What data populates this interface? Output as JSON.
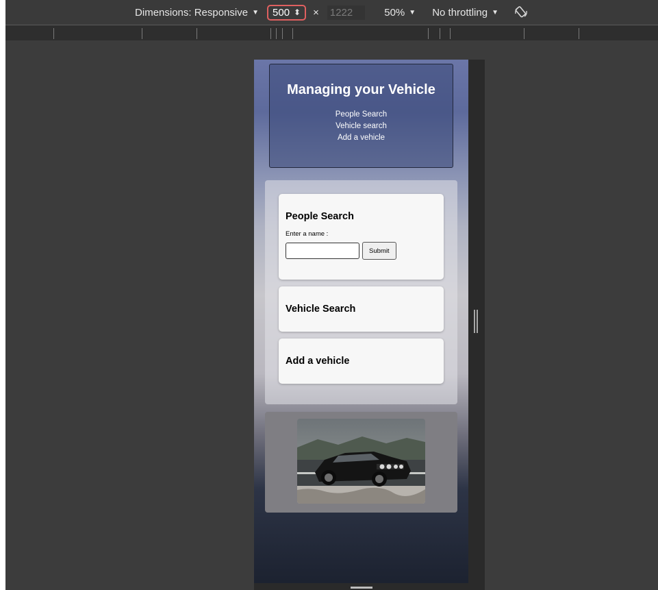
{
  "devtools": {
    "dimensions_label": "Dimensions: Responsive",
    "width_value": "500",
    "times_symbol": "×",
    "height_value": "1222",
    "zoom_label": "50%",
    "throttling_label": "No throttling",
    "icons": {
      "dimensions_dropdown": "chevron-down-icon",
      "width_spinner": "spinner-icon",
      "rotate": "rotate-icon"
    }
  },
  "page": {
    "header": {
      "title": "Managing your Vehicle",
      "nav": [
        "People Search",
        "Vehicle search",
        "Add a vehicle"
      ]
    },
    "people_search": {
      "heading": "People Search",
      "field_label": "Enter a name :",
      "input_value": "",
      "submit_label": "Submit"
    },
    "vehicle_search": {
      "heading": "Vehicle Search"
    },
    "add_vehicle": {
      "heading": "Add a vehicle"
    },
    "image": {
      "subject": "car-photo"
    }
  },
  "colors": {
    "devtools_bg": "#3c3c3c",
    "width_box_border": "#e06060",
    "header_bg": "#3a4878",
    "card_bg": "#f7f7f7",
    "image_box_bg": "#7f7e83"
  }
}
